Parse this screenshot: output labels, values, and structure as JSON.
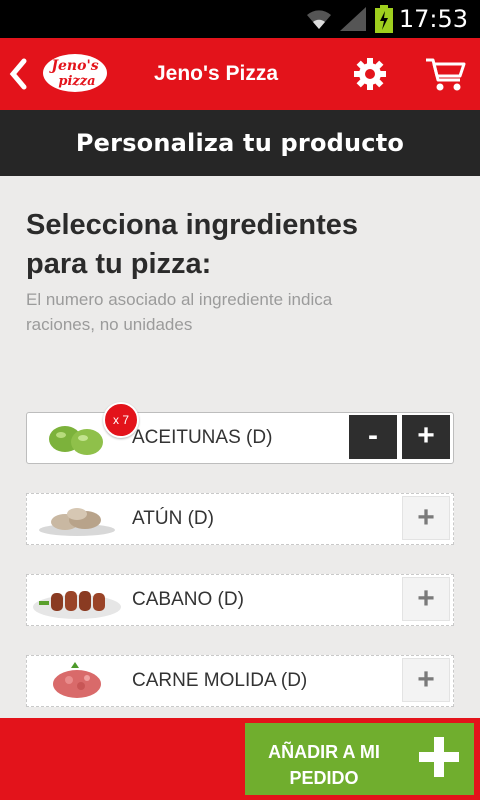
{
  "status_bar": {
    "time": "17:53"
  },
  "app_bar": {
    "title": "Jeno's Pizza",
    "logo_text_top": "Jeno's",
    "logo_text_bottom": "pizza"
  },
  "sub_header": {
    "title": "Personaliza tu producto"
  },
  "content": {
    "heading_line1": "Selecciona ingredientes",
    "heading_line2": "para tu pizza:",
    "subtext_line1": "El numero asociado al ingrediente indica",
    "subtext_line2": "raciones, no unidades"
  },
  "ingredients": [
    {
      "name": "ACEITUNAS (D)",
      "qty_badge": "x 7",
      "minus": "-",
      "plus": "+"
    },
    {
      "name": "ATÚN (D)",
      "plus": "+"
    },
    {
      "name": "CABANO (D)",
      "plus": "+"
    },
    {
      "name": "CARNE MOLIDA (D)",
      "plus": "+"
    }
  ],
  "bottom_bar": {
    "add_line1": "AÑADIR A MI",
    "add_line2": "PEDIDO"
  },
  "colors": {
    "brand_red": "#e3131b",
    "dark_header": "#262626",
    "add_green": "#70ae2e"
  }
}
